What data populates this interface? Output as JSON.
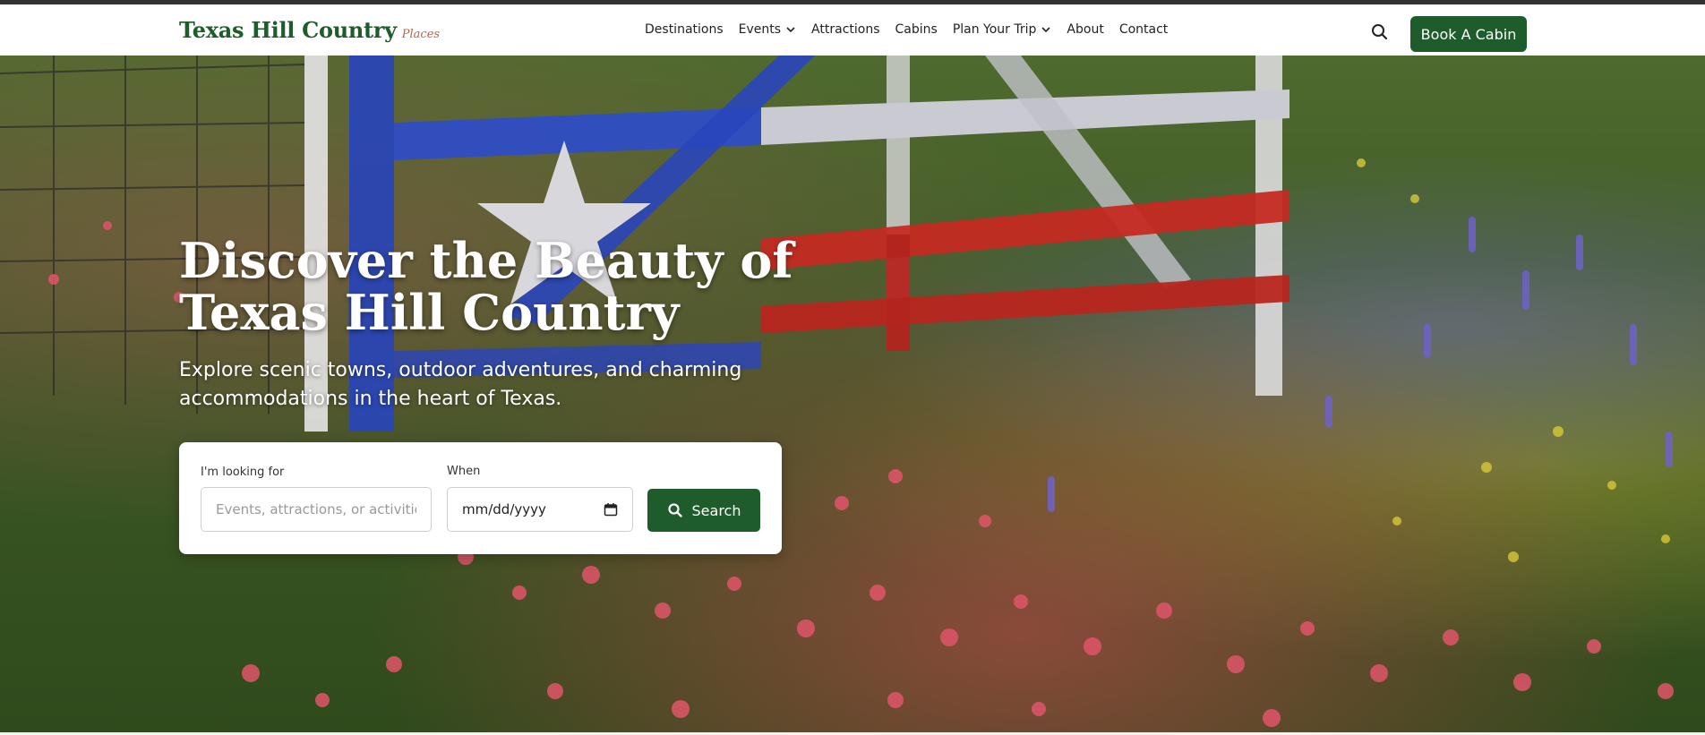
{
  "brand": {
    "name": "Texas Hill Country",
    "tagline": "Places"
  },
  "nav": {
    "items": [
      {
        "label": "Destinations",
        "dropdown": false
      },
      {
        "label": "Events",
        "dropdown": true
      },
      {
        "label": "Attractions",
        "dropdown": false
      },
      {
        "label": "Cabins",
        "dropdown": false
      },
      {
        "label": "Plan Your Trip",
        "dropdown": true
      },
      {
        "label": "About",
        "dropdown": false
      },
      {
        "label": "Contact",
        "dropdown": false
      }
    ],
    "search_icon": "search-icon",
    "cta_label": "Book A Cabin"
  },
  "hero": {
    "title_line1": "Discover the Beauty of",
    "title_line2": "Texas Hill Country",
    "subtitle": "Explore scenic towns, outdoor adventures, and charming accommodations in the heart of Texas."
  },
  "search": {
    "looking_for_label": "I'm looking for",
    "looking_for_placeholder": "Events, attractions, or activities",
    "when_label": "When",
    "date_placeholder": "mm/dd/yyyy",
    "submit_label": "Search"
  },
  "colors": {
    "brand_green": "#1f5c2b",
    "tagline_rust": "#b4624a",
    "topbar": "#333333"
  }
}
